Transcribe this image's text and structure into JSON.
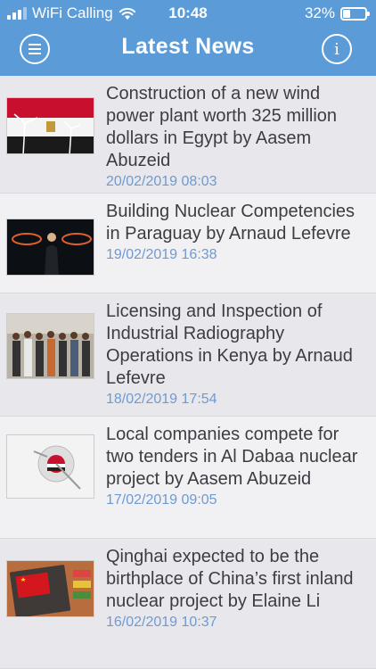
{
  "status_bar": {
    "carrier": "WiFi Calling",
    "time": "10:48",
    "battery": "32%",
    "battery_level": 0.32,
    "signal_icon": "cellular-signal-icon",
    "wifi_icon": "wifi-icon"
  },
  "header": {
    "title": "Latest News",
    "menu_icon": "hamburger-menu-icon",
    "info_icon": "info-icon",
    "info_glyph": "i",
    "background": "#5b9bd8"
  },
  "news": [
    {
      "headline": "Construction of a new wind power plant worth 325 million dollars in Egypt by Aasem Abuzeid",
      "date": "20/02/2019 08:03",
      "thumbnail": "egypt-flag-wind-turbines"
    },
    {
      "headline": "Building Nuclear Competencies in Paraguay by Arnaud Lefevre",
      "date": "19/02/2019 16:38",
      "thumbnail": "person-holding-glowing-key"
    },
    {
      "headline": "Licensing and Inspection of Industrial Radiography Operations in Kenya by Arnaud Lefevre",
      "date": "18/02/2019 17:54",
      "thumbnail": "group-photo"
    },
    {
      "headline": "Local companies compete for two tenders in Al Dabaa nuclear project by Aasem Abuzeid",
      "date": "17/02/2019 09:05",
      "thumbnail": "invest-compass-egypt-flag"
    },
    {
      "headline": "Qinghai expected to be the birthplace of China’s first inland nuclear project by Elaine Li",
      "date": "16/02/2019 10:37",
      "thumbnail": "china-flag-notebook"
    }
  ]
}
